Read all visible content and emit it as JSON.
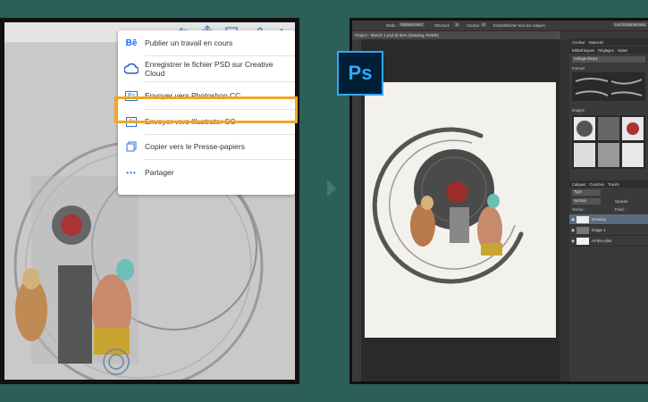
{
  "share_menu": {
    "items": [
      {
        "icon": "behance-icon",
        "label": "Publier un travail en cours"
      },
      {
        "icon": "creative-cloud-icon",
        "label": "Enregistrer le fichier PSD sur Creative Cloud"
      },
      {
        "icon": "photoshop-icon",
        "label": "Envoyer vers Photoshop CC",
        "highlighted": true
      },
      {
        "icon": "illustrator-icon",
        "label": "Envoyer vers Illustrator CC"
      },
      {
        "icon": "copy-icon",
        "label": "Copier vers le Presse-papiers"
      },
      {
        "icon": "more-icon",
        "label": "Partager"
      }
    ],
    "icon_glyphs": {
      "behance": "Bē",
      "photoshop": "Ps",
      "illustrator": "Ai",
      "more": "•••"
    }
  },
  "toolbar": {
    "icons": [
      "undo-icon",
      "share-icon",
      "image-icon",
      "pen-icon",
      "fill-icon"
    ]
  },
  "photoshop": {
    "logo_text": "Ps",
    "options_bar": {
      "mode_label": "Mode :",
      "mode_value": "Déplacement",
      "structure_label": "Structure",
      "structure_value": "4",
      "couleur_label": "Couleur",
      "couleur_value": "4",
      "sample_all_label": "Échantillonner tous les calques",
      "workspace_label": "Les fondamentaux"
    },
    "document_tab": "Project - Sketch 1.psd @ 50% (Drawing, RVB/8)",
    "libraries_panel": {
      "tabs": [
        "Couleur",
        "Nuancier"
      ],
      "subtabs": [
        "Bibliothèques",
        "Réglages",
        "Styles"
      ],
      "library_name": "Collage library",
      "sections": [
        "Formes",
        "Images"
      ]
    },
    "layers_panel": {
      "tabs": [
        "Calques",
        "Couches",
        "Tracés"
      ],
      "filter_label": "Type",
      "blend_mode": "Normal",
      "opacity_label": "Opacité",
      "lock_label": "Verrou :",
      "fill_label": "Fond :",
      "layers": [
        {
          "name": "Drawing",
          "selected": true
        },
        {
          "name": "Image 1",
          "selected": false
        },
        {
          "name": "Arrière-plan",
          "selected": false
        }
      ]
    }
  },
  "colors": {
    "background": "#2b5f57",
    "highlight": "#f2a623",
    "ps_blue": "#31a8ff",
    "ps_dark": "#001e36"
  }
}
